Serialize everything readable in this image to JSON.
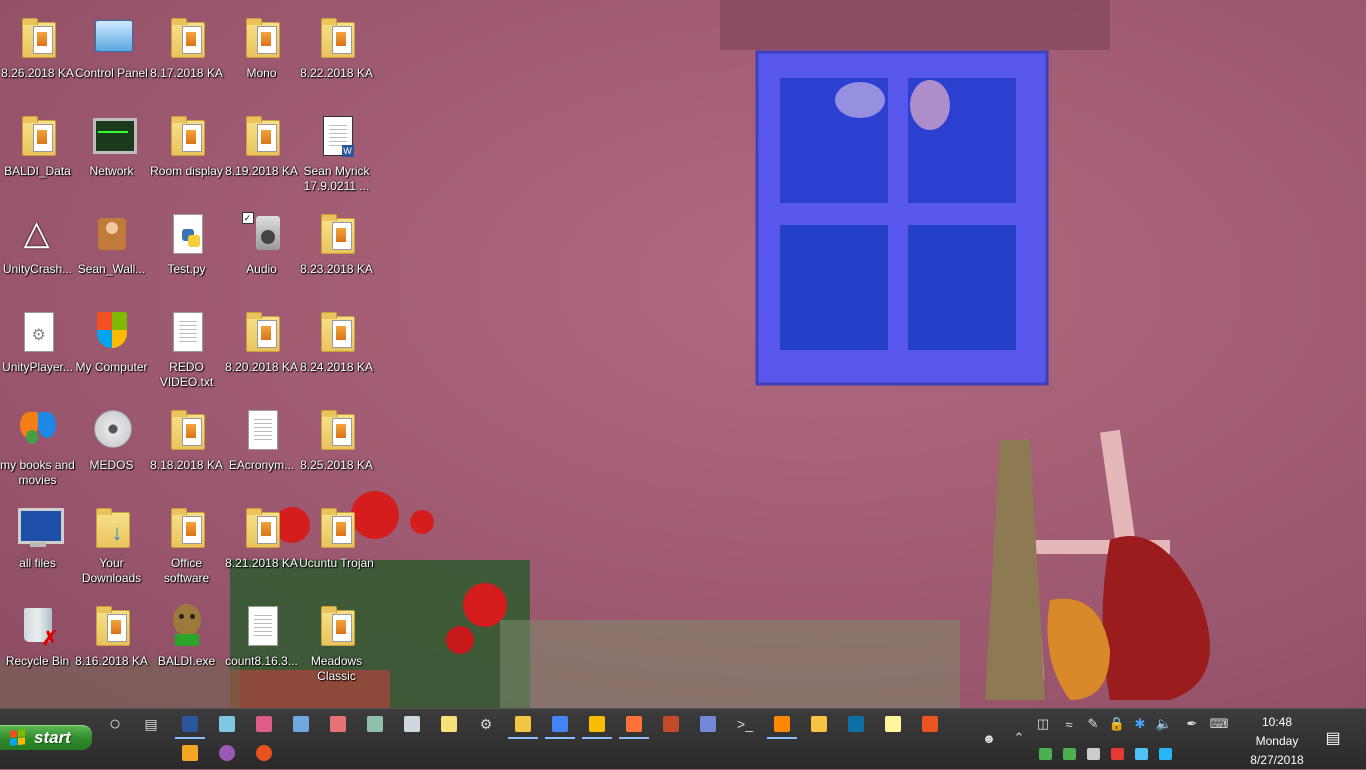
{
  "desktop": {
    "icons": [
      {
        "label": "8.26.2018 KA",
        "icon": "folder-icon"
      },
      {
        "label": "Control Panel",
        "icon": "control-panel-icon"
      },
      {
        "label": "8.17.2018 KA",
        "icon": "folder-icon"
      },
      {
        "label": "Mono",
        "icon": "folder-icon"
      },
      {
        "label": "8.22.2018 KA",
        "icon": "folder-icon"
      },
      {
        "label": "BALDI_Data",
        "icon": "folder-icon"
      },
      {
        "label": "Network",
        "icon": "network-icon"
      },
      {
        "label": "Room display",
        "icon": "folder-icon"
      },
      {
        "label": "8.19.2018 KA",
        "icon": "folder-icon"
      },
      {
        "label": "Sean Myrick 17.9.0211 ...",
        "icon": "word-document-icon"
      },
      {
        "label": "UnityCrash...",
        "icon": "unity-icon"
      },
      {
        "label": "Sean_Wall...",
        "icon": "user-wallpaper-icon"
      },
      {
        "label": "Test.py",
        "icon": "python-file-icon"
      },
      {
        "label": "Audio",
        "icon": "audio-icon"
      },
      {
        "label": "8.23.2018 KA",
        "icon": "folder-icon"
      },
      {
        "label": "UnityPlayer...",
        "icon": "settings-file-icon"
      },
      {
        "label": "My Computer",
        "icon": "shield-icon"
      },
      {
        "label": "REDO VIDEO.txt",
        "icon": "text-file-icon"
      },
      {
        "label": "8.20.2018 KA",
        "icon": "folder-icon"
      },
      {
        "label": "8.24.2018 KA",
        "icon": "folder-icon"
      },
      {
        "label": "my books and movies",
        "icon": "butterfly-icon"
      },
      {
        "label": "MEDOS",
        "icon": "disc-icon"
      },
      {
        "label": "8.18.2018 KA",
        "icon": "folder-icon"
      },
      {
        "label": "EAcronym...",
        "icon": "text-file-icon"
      },
      {
        "label": "8.25.2018 KA",
        "icon": "folder-icon"
      },
      {
        "label": "all files",
        "icon": "monitor-icon"
      },
      {
        "label": "Your Downloads",
        "icon": "downloads-folder-icon"
      },
      {
        "label": "Office software",
        "icon": "folder-icon"
      },
      {
        "label": "8.21.2018 KA",
        "icon": "folder-icon"
      },
      {
        "label": "Ucuntu Trojan",
        "icon": "folder-icon"
      },
      {
        "label": "Recycle Bin",
        "icon": "recycle-bin-icon"
      },
      {
        "label": "8.16.2018 KA",
        "icon": "folder-icon"
      },
      {
        "label": "BALDI.exe",
        "icon": "baldi-icon"
      },
      {
        "label": "count8.16.3...",
        "icon": "text-file-icon"
      },
      {
        "label": "Meadows Classic",
        "icon": "folder-icon"
      }
    ]
  },
  "taskbar": {
    "start_label": "start",
    "pinned_top": [
      "cortana-icon",
      "task-view-icon",
      "word-icon",
      "photos-icon",
      "paint-icon",
      "notepad-doc-icon",
      "palette-icon",
      "image-viewer-icon",
      "calculator-icon",
      "sticky-notes-icon",
      "settings-icon",
      "file-explorer-icon",
      "chrome-icon",
      "chrome-alt-icon",
      "firefox-icon",
      "winrar-icon",
      "discord-icon",
      "terminal-icon",
      "vlc-icon",
      "winamp-icon",
      "book-icon",
      "notes-icon",
      "ubuntu-like-icon"
    ],
    "pinned_bottom": [
      "media-player-icon",
      "maps-icon",
      "ubuntu-icon"
    ],
    "tray_top": [
      "people-icon",
      "chevron-up-icon",
      "usb-icon",
      "wifi-icon",
      "pen-icon",
      "lock-icon",
      "bluetooth-icon",
      "volume-icon",
      "handwriting-icon",
      "keyboard-icon"
    ],
    "tray_bottom": [
      "battery-icon",
      "defender-icon",
      "discord-tray-icon",
      "mic-off-icon",
      "onedrive-icon",
      "update-icon"
    ],
    "clock": {
      "time": "10:48",
      "day": "Monday",
      "date": "8/27/2018"
    },
    "notifications_icon": "action-center-icon"
  },
  "colors": {
    "wall": "#a35f75",
    "window_frame": "#5b5bf0",
    "taskbar": "#2f2f2f",
    "start_green": "#3a9a34"
  }
}
